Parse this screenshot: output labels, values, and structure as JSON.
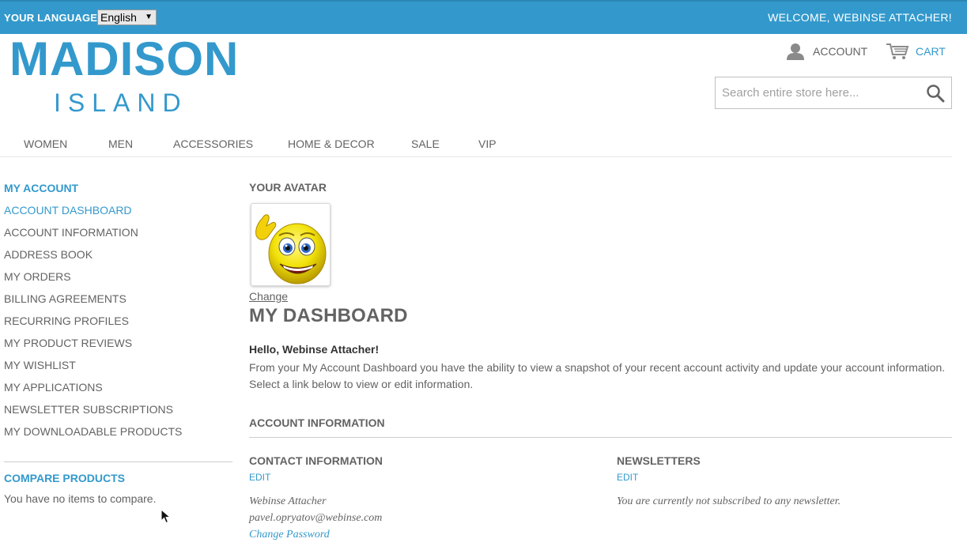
{
  "topbar": {
    "language_label": "YOUR LANGUAGE:",
    "language_selected": "English",
    "welcome": "WELCOME, WEBINSE ATTACHER!"
  },
  "logo": {
    "top": "MADISON",
    "bottom": "ISLAND"
  },
  "header": {
    "account_label": "ACCOUNT",
    "cart_label": "CART",
    "search_placeholder": "Search entire store here..."
  },
  "nav": [
    "WOMEN",
    "MEN",
    "ACCESSORIES",
    "HOME & DECOR",
    "SALE",
    "VIP"
  ],
  "sidebar": {
    "title": "MY ACCOUNT",
    "items": [
      "ACCOUNT DASHBOARD",
      "ACCOUNT INFORMATION",
      "ADDRESS BOOK",
      "MY ORDERS",
      "BILLING AGREEMENTS",
      "RECURRING PROFILES",
      "MY PRODUCT REVIEWS",
      "MY WISHLIST",
      "MY APPLICATIONS",
      "NEWSLETTER SUBSCRIPTIONS",
      "MY DOWNLOADABLE PRODUCTS"
    ],
    "compare_title": "COMPARE PRODUCTS",
    "compare_text": "You have no items to compare."
  },
  "main": {
    "avatar_title": "YOUR AVATAR",
    "avatar_change": "Change",
    "dashboard_title": "MY DASHBOARD",
    "hello": "Hello, Webinse Attacher!",
    "intro_line1": "From your My Account Dashboard you have the ability to view a snapshot of your recent account activity and update your account information.",
    "intro_line2": "Select a link below to view or edit information.",
    "account_info_title": "ACCOUNT INFORMATION",
    "contact": {
      "title": "CONTACT INFORMATION",
      "edit": "EDIT",
      "name": "Webinse Attacher",
      "email": "pavel.opryatov@webinse.com",
      "change_password": "Change Password"
    },
    "newsletters": {
      "title": "NEWSLETTERS",
      "edit": "EDIT",
      "status": "You are currently not subscribed to any newsletter."
    }
  },
  "colors": {
    "brand": "#3399cc",
    "text": "#636363"
  }
}
